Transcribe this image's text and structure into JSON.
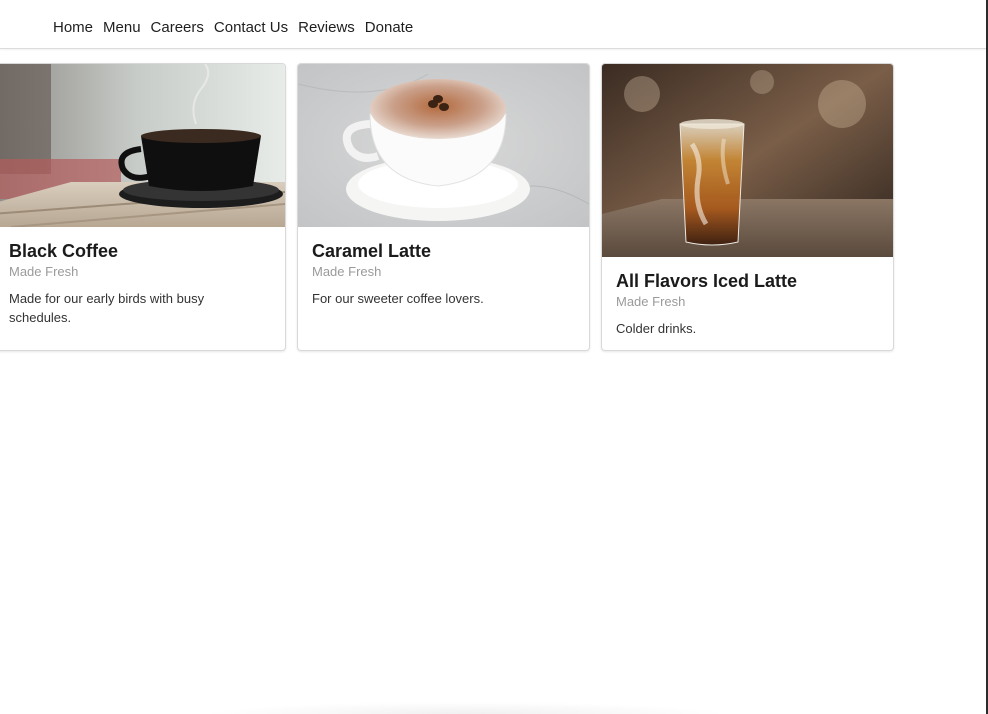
{
  "nav": {
    "items": [
      {
        "label": "Home"
      },
      {
        "label": "Menu"
      },
      {
        "label": "Careers"
      },
      {
        "label": "Contact Us"
      },
      {
        "label": "Reviews"
      },
      {
        "label": "Donate"
      }
    ]
  },
  "cards": [
    {
      "title": "Black Coffee",
      "meta": "Made Fresh",
      "description": "Made for our early birds with busy schedules.",
      "image_icon": "black-coffee-photo"
    },
    {
      "title": "Caramel Latte",
      "meta": "Made Fresh",
      "description": "For our sweeter coffee lovers.",
      "image_icon": "caramel-latte-photo"
    },
    {
      "title": "All Flavors Iced Latte",
      "meta": "Made Fresh",
      "description": "Colder drinks.",
      "image_icon": "iced-latte-photo"
    }
  ],
  "colors": {
    "nav_text": "#1f1f1f",
    "title": "#1b1b1b",
    "meta": "#9a9a9a",
    "body": "#333333",
    "card_border": "#d9d9d9"
  }
}
